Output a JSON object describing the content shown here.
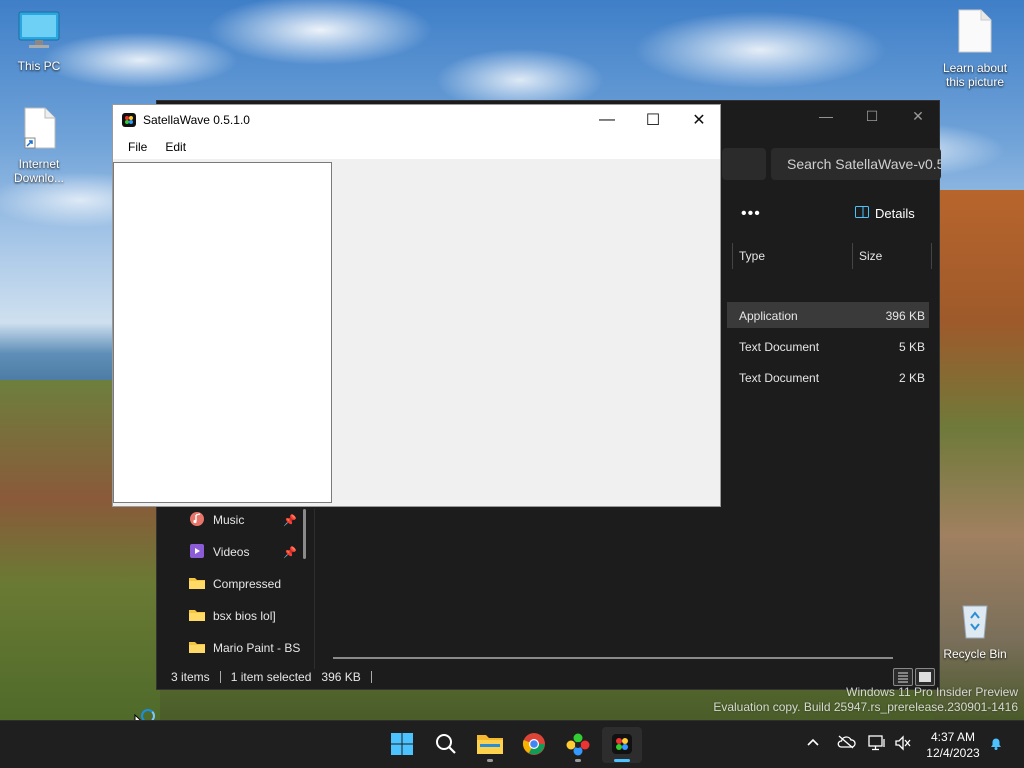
{
  "desktop": {
    "icons": [
      {
        "label": "This PC"
      },
      {
        "label": "Internet Downlo..."
      },
      {
        "label": "Learn about this picture"
      },
      {
        "label": "Recycle Bin"
      }
    ]
  },
  "explorer": {
    "search_text": "Search SatellaWave-v0.5.",
    "more_label": "•••",
    "details_label": "Details",
    "columns": {
      "type": "Type",
      "size": "Size"
    },
    "rows": [
      {
        "type": "Application",
        "size": "396 KB",
        "selected": true
      },
      {
        "type": "Text Document",
        "size": "5 KB",
        "selected": false
      },
      {
        "type": "Text Document",
        "size": "2 KB",
        "selected": false
      }
    ],
    "nav": [
      {
        "label": "Music",
        "pinned": true
      },
      {
        "label": "Videos",
        "pinned": true
      },
      {
        "label": "Compressed",
        "pinned": false
      },
      {
        "label": "bsx bios lol]",
        "pinned": false
      },
      {
        "label": "Mario Paint - BS",
        "pinned": false
      }
    ],
    "status": {
      "items": "3 items",
      "selected": "1 item selected",
      "size": "396 KB"
    }
  },
  "satellawave": {
    "title": "SatellaWave 0.5.1.0",
    "menu": [
      "File",
      "Edit"
    ]
  },
  "watermark": {
    "line1": "Windows 11 Pro Insider Preview",
    "line2": "Evaluation copy. Build 25947.rs_prerelease.230901-1416"
  },
  "taskbar": {
    "apps": [
      "start-icon",
      "search-icon",
      "file-explorer-icon",
      "chrome-icon",
      "snes-app-icon",
      "satellawave-icon"
    ],
    "clock": {
      "time": "4:37 AM",
      "date": "12/4/2023"
    }
  }
}
